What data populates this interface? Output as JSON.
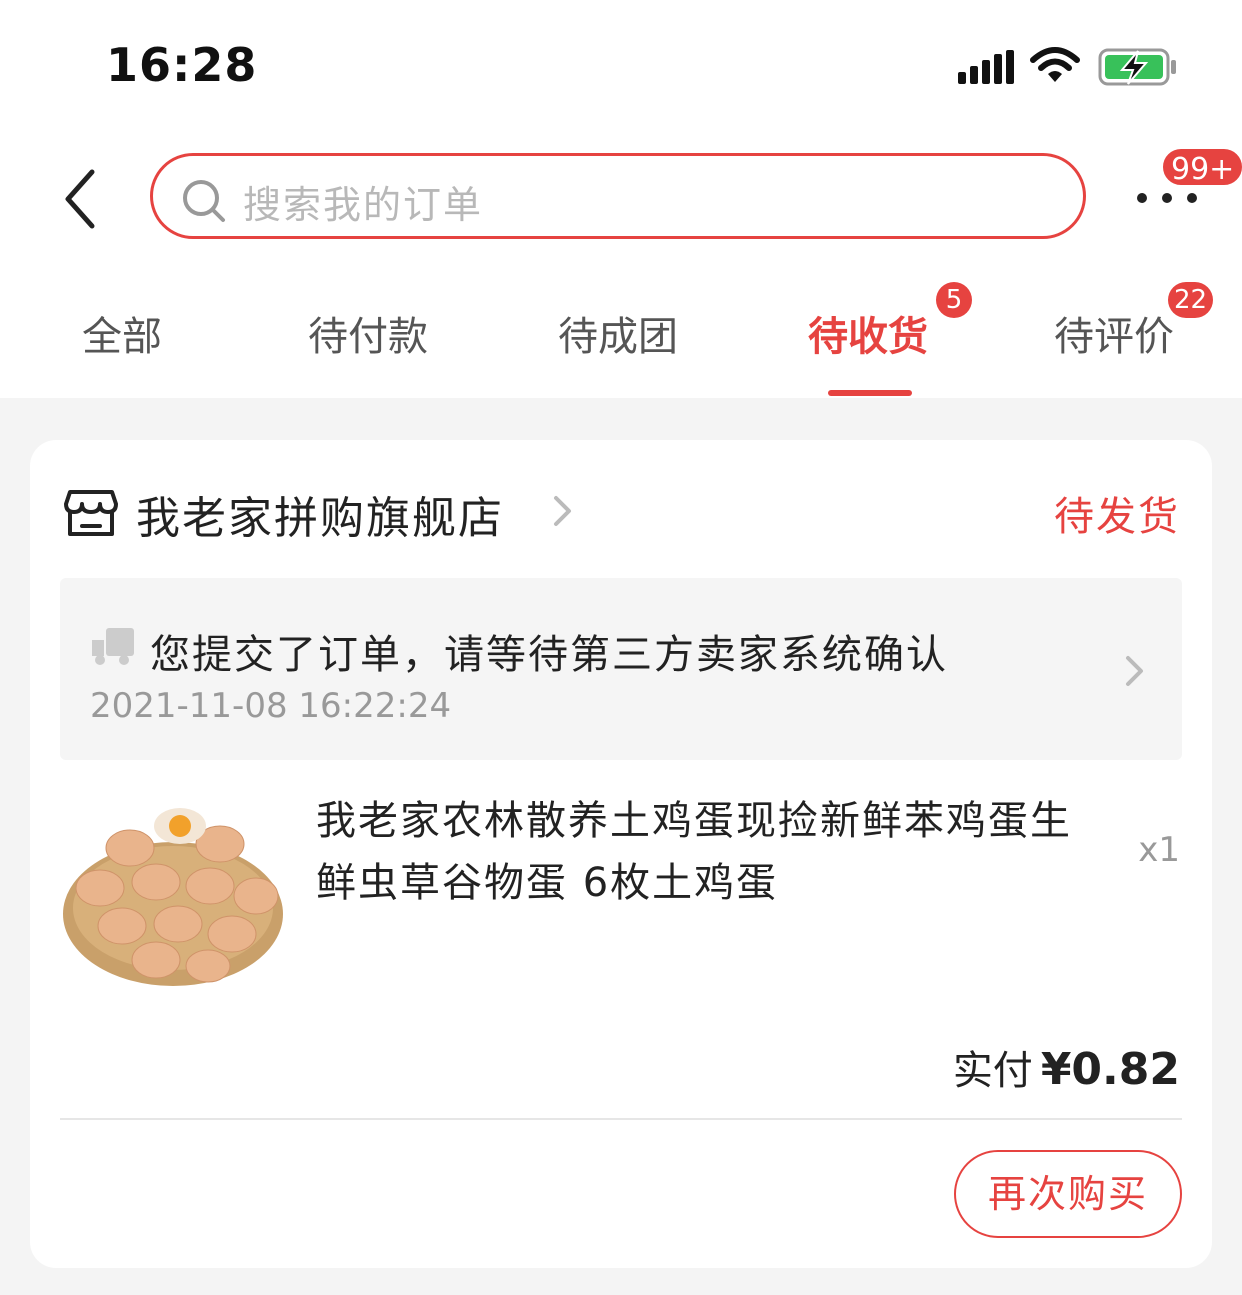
{
  "status_bar": {
    "time": "16:28"
  },
  "header": {
    "back_icon": "chevron-left-icon",
    "search_placeholder": "搜索我的订单",
    "more_icon": "more-dots-icon",
    "more_badge": "99+"
  },
  "tabs": [
    {
      "label": "全部",
      "badge": ""
    },
    {
      "label": "待付款",
      "badge": ""
    },
    {
      "label": "待成团",
      "badge": ""
    },
    {
      "label": "待收货",
      "badge": "5",
      "active": true
    },
    {
      "label": "待评价",
      "badge": "22"
    }
  ],
  "colors": {
    "accent": "#e64340",
    "background": "#f4f4f4",
    "card": "#ffffff"
  },
  "order": {
    "store_icon": "store-icon",
    "store_name": "我老家拼购旗舰店",
    "status": "待发货",
    "logistics": {
      "icon": "truck-icon",
      "message": "您提交了订单，请等待第三方卖家系统确认",
      "time": "2021-11-08 16:22:24"
    },
    "product": {
      "image": "eggs-basket-image",
      "title": "我老家农林散养土鸡蛋现捡新鲜苯鸡蛋生鲜虫草谷物蛋 6枚土鸡蛋",
      "quantity": "x1"
    },
    "paid_label": "实付",
    "paid_amount": "¥0.82",
    "rebuy_label": "再次购买"
  }
}
